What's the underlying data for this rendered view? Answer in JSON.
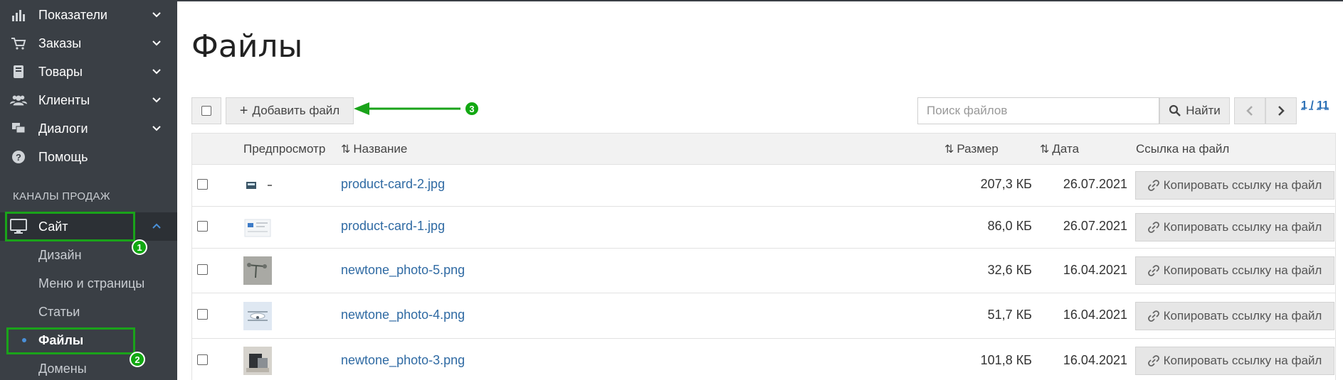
{
  "sidebar": {
    "items": [
      {
        "label": "Показатели",
        "icon": "bar-chart-icon"
      },
      {
        "label": "Заказы",
        "icon": "cart-icon"
      },
      {
        "label": "Товары",
        "icon": "book-icon"
      },
      {
        "label": "Клиенты",
        "icon": "users-icon"
      },
      {
        "label": "Диалоги",
        "icon": "chat-icon"
      },
      {
        "label": "Помощь",
        "icon": "help-icon"
      }
    ],
    "section_title": "КАНАЛЫ ПРОДАЖ",
    "site": {
      "label": "Сайт",
      "icon": "monitor-icon"
    },
    "subitems": [
      {
        "label": "Дизайн"
      },
      {
        "label": "Меню и страницы"
      },
      {
        "label": "Статьи"
      },
      {
        "label": "Файлы"
      },
      {
        "label": "Домены"
      }
    ]
  },
  "annotations": {
    "badge1": "1",
    "badge2": "2",
    "badge3": "3",
    "highlight_color": "#1aa31a"
  },
  "main": {
    "title": "Файлы",
    "add_button": "Добавить файл",
    "search_placeholder": "Поиск файлов",
    "search_button": "Найти",
    "pagination": "1 / 11"
  },
  "table": {
    "headers": {
      "preview": "Предпросмотр",
      "name": "Название",
      "size": "Размер",
      "date": "Дата",
      "link": "Ссылка на файл"
    },
    "copy_label": "Копировать ссылку на файл",
    "rows": [
      {
        "name": "product-card-2.jpg",
        "size": "207,3 КБ",
        "date": "26.07.2021"
      },
      {
        "name": "product-card-1.jpg",
        "size": "86,0 КБ",
        "date": "26.07.2021"
      },
      {
        "name": "newtone_photo-5.png",
        "size": "32,6 КБ",
        "date": "16.04.2021"
      },
      {
        "name": "newtone_photo-4.png",
        "size": "51,7 КБ",
        "date": "16.04.2021"
      },
      {
        "name": "newtone_photo-3.png",
        "size": "101,8 КБ",
        "date": "16.04.2021"
      }
    ]
  }
}
